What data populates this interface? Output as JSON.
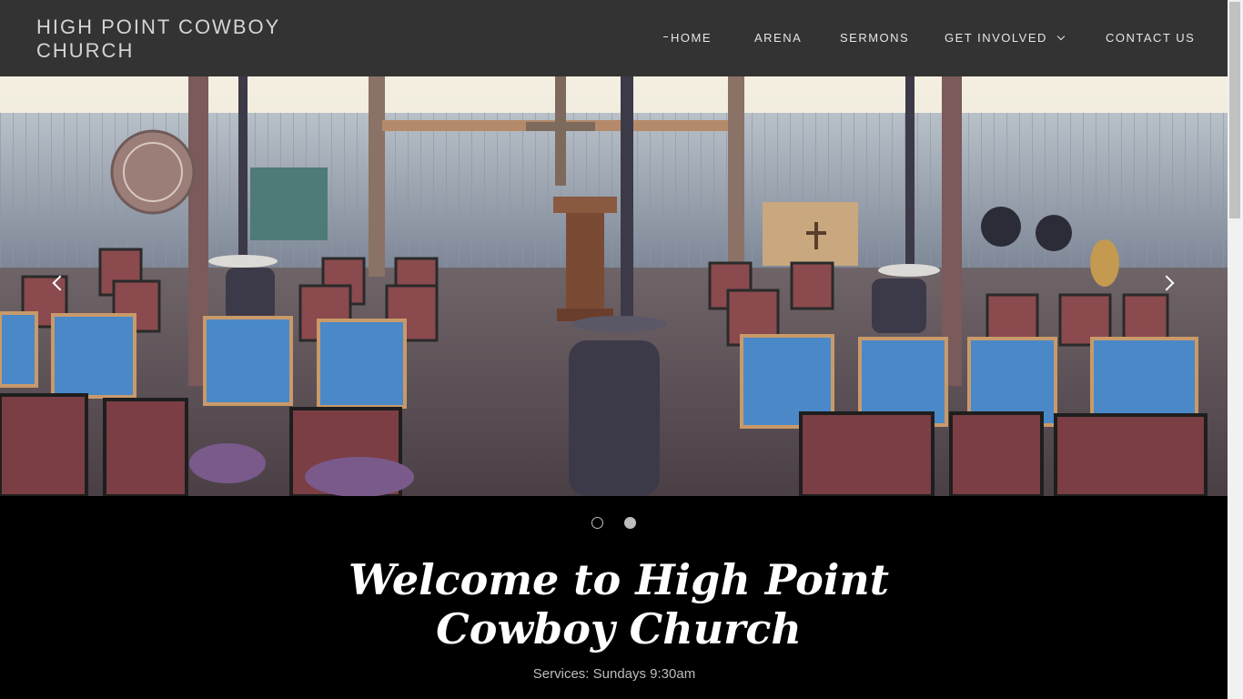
{
  "header": {
    "site_title": "HIGH POINT COWBOY CHURCH",
    "nav": {
      "home": "HOME",
      "arena": "ARENA",
      "sermons": "SERMONS",
      "get_involved": "GET INVOLVED",
      "contact": "CONTACT US"
    }
  },
  "hero": {
    "image_alt": "Church interior with chairs, pulpit and patio heaters",
    "prev_icon": "chevron-left-icon",
    "next_icon": "chevron-right-icon",
    "slide_count": 2,
    "active_slide": 2
  },
  "welcome": {
    "heading": "Welcome to High Point Cowboy Church",
    "services": "Services: Sundays 9:30am"
  },
  "colors": {
    "header_bg": "#333333",
    "page_bg": "#000000",
    "title_text": "#d4d4d4",
    "nav_text": "#e6e6e6"
  }
}
